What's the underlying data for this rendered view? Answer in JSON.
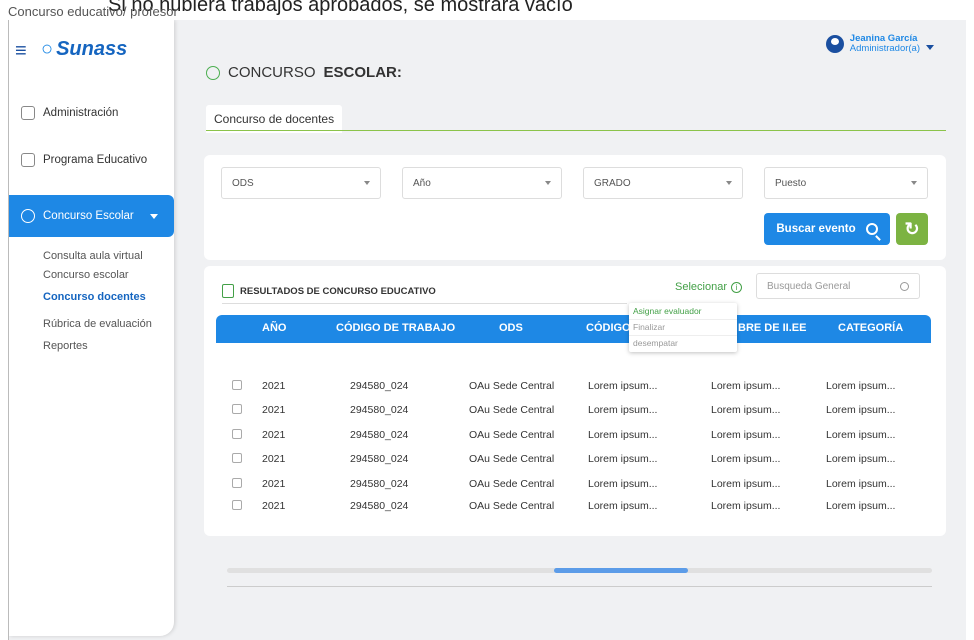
{
  "top_note": "Si no hubiera trabajos aprobados, se mostrará vacío",
  "breadcrumb": "Concurso educativo/ profesor",
  "brand": {
    "logo": "Sunass"
  },
  "user": {
    "name": "Jeanina García",
    "role": "Administrador(a)"
  },
  "sidebar": {
    "items": [
      {
        "label": "Administración",
        "icon": "admin-icon"
      },
      {
        "label": "Programa Educativo",
        "icon": "program-icon"
      }
    ],
    "active": {
      "label": "Concurso Escolar",
      "icon": "award-icon"
    },
    "subitems": [
      {
        "label": "Consulta aula virtual"
      },
      {
        "label": "Concurso escolar"
      },
      {
        "label": "Concurso docentes"
      },
      {
        "label": "Rúbrica de evaluación"
      },
      {
        "label": "Reportes"
      }
    ]
  },
  "page": {
    "title_prefix": "CONCURSO",
    "title_bold": "ESCOLAR:",
    "tab": "Concurso de docentes"
  },
  "filters": {
    "ods": "ODS",
    "anio": "Año",
    "grado": "GRADO",
    "puesto": "Puesto",
    "search_button": "Buscar evento",
    "refresh_icon": "refresh-icon"
  },
  "results": {
    "title": "RESULTADOS DE CONCURSO EDUCATIVO",
    "selecionar": "Selecionar",
    "global_search_placeholder": "Busqueda General",
    "columns": [
      "AÑO",
      "CÓDIGO DE TRABAJO",
      "ODS",
      "CÓDIGO I",
      "BRE DE II.EE",
      "CATEGORÍA"
    ],
    "rows": [
      [
        "2021",
        "294580_024",
        "OAu Sede Central",
        "Lorem ipsum...",
        "Lorem ipsum...",
        "Lorem ipsum..."
      ],
      [
        "2021",
        "294580_024",
        "OAu Sede Central",
        "Lorem ipsum...",
        "Lorem ipsum...",
        "Lorem ipsum..."
      ],
      [
        "2021",
        "294580_024",
        "OAu Sede Central",
        "Lorem ipsum...",
        "Lorem ipsum...",
        "Lorem ipsum..."
      ],
      [
        "2021",
        "294580_024",
        "OAu Sede Central",
        "Lorem ipsum...",
        "Lorem ipsum...",
        "Lorem ipsum..."
      ],
      [
        "2021",
        "294580_024",
        "OAu Sede Central",
        "Lorem ipsum...",
        "Lorem ipsum...",
        "Lorem ipsum..."
      ],
      [
        "2021",
        "294580_024",
        "OAu Sede Central",
        "Lorem ipsum...",
        "Lorem ipsum...",
        "Lorem ipsum..."
      ]
    ],
    "dropdown": [
      "Asignar evaluador",
      "Finalizar",
      "desempatar"
    ]
  },
  "colors": {
    "primary": "#1e88e5",
    "accent_green": "#7cb342",
    "text_green": "#43a047"
  }
}
